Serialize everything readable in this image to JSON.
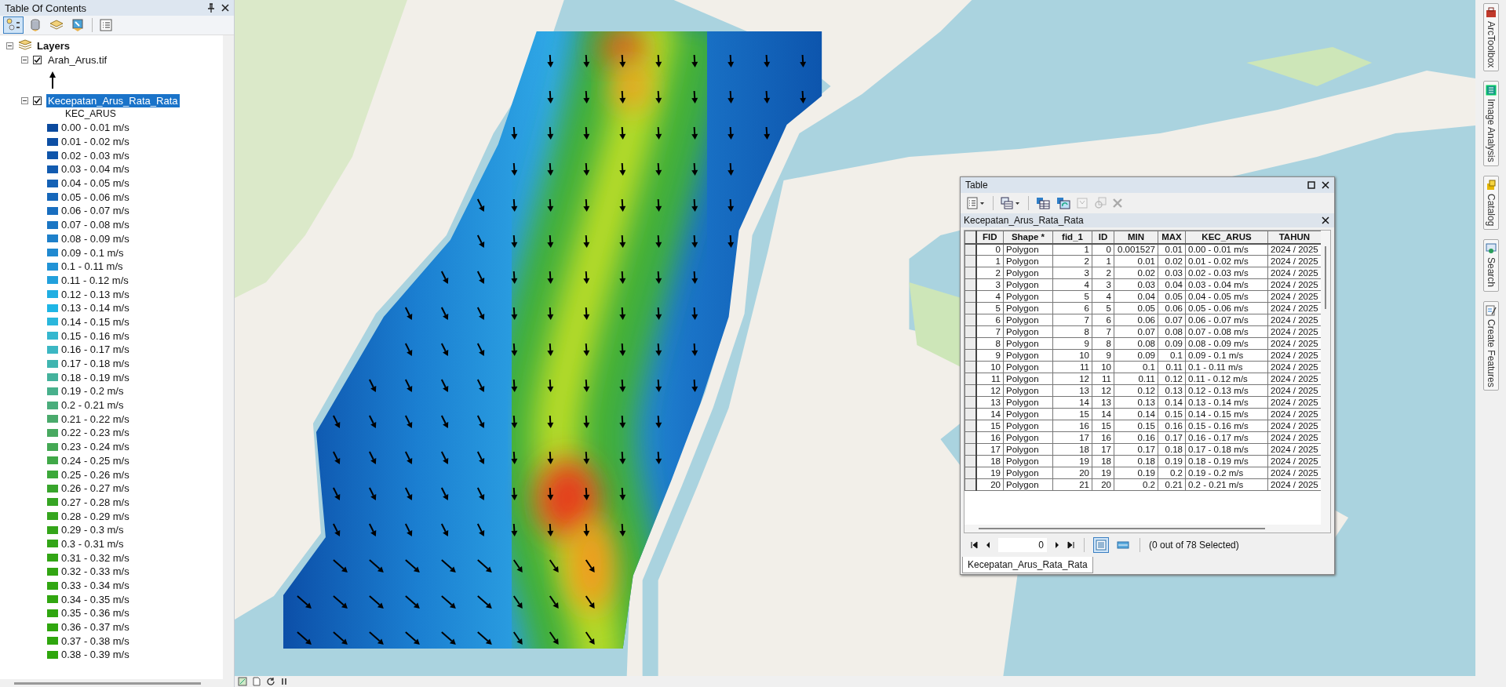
{
  "toc": {
    "title": "Table Of Contents",
    "root": {
      "label": "Layers",
      "expanded": true
    },
    "layers": [
      {
        "kind": "arrow-raster",
        "name": "Arah_Arus.tif",
        "checked": true,
        "expanded": true,
        "selected": false
      },
      {
        "kind": "classes",
        "name": "Kecepatan_Arus_Rata_Rata",
        "checked": true,
        "expanded": true,
        "selected": true,
        "field": "KEC_ARUS",
        "classes": [
          {
            "label": "0.00 - 0.01 m/s",
            "color": "#0b4a9e"
          },
          {
            "label": "0.01 - 0.02 m/s",
            "color": "#0d4fa4"
          },
          {
            "label": "0.02 - 0.03 m/s",
            "color": "#0f55aa"
          },
          {
            "label": "0.03 - 0.04 m/s",
            "color": "#125bb0"
          },
          {
            "label": "0.04 - 0.05 m/s",
            "color": "#1461b5"
          },
          {
            "label": "0.05 - 0.06 m/s",
            "color": "#1667ba"
          },
          {
            "label": "0.06 - 0.07 m/s",
            "color": "#196ebf"
          },
          {
            "label": "0.07 - 0.08 m/s",
            "color": "#1b76c4"
          },
          {
            "label": "0.08 - 0.09 m/s",
            "color": "#1e80ca"
          },
          {
            "label": "0.09 - 0.1 m/s",
            "color": "#2089d0"
          },
          {
            "label": "0.1 - 0.11 m/s",
            "color": "#2193d6"
          },
          {
            "label": "0.11 - 0.12 m/s",
            "color": "#22a0dc"
          },
          {
            "label": "0.12 - 0.13 m/s",
            "color": "#20aee2"
          },
          {
            "label": "0.13 - 0.14 m/s",
            "color": "#1eb6e6"
          },
          {
            "label": "0.14 - 0.15 m/s",
            "color": "#2ab7dc"
          },
          {
            "label": "0.15 - 0.16 m/s",
            "color": "#35b7cf"
          },
          {
            "label": "0.16 - 0.17 m/s",
            "color": "#3cb7c3"
          },
          {
            "label": "0.17 - 0.18 m/s",
            "color": "#40b5b0"
          },
          {
            "label": "0.18 - 0.19 m/s",
            "color": "#44b29c"
          },
          {
            "label": "0.19 - 0.2 m/s",
            "color": "#48b08c"
          },
          {
            "label": "0.2 - 0.21 m/s",
            "color": "#4aad7c"
          },
          {
            "label": "0.21 - 0.22 m/s",
            "color": "#4aaa6c"
          },
          {
            "label": "0.22 - 0.23 m/s",
            "color": "#48a960"
          },
          {
            "label": "0.23 - 0.24 m/s",
            "color": "#44a854"
          },
          {
            "label": "0.24 - 0.25 m/s",
            "color": "#40a848"
          },
          {
            "label": "0.25 - 0.26 m/s",
            "color": "#3ca83a"
          },
          {
            "label": "0.26 - 0.27 m/s",
            "color": "#38a52c"
          },
          {
            "label": "0.27 - 0.28 m/s",
            "color": "#36a524"
          },
          {
            "label": "0.28 - 0.29 m/s",
            "color": "#35a51e"
          },
          {
            "label": "0.29 - 0.3 m/s",
            "color": "#34a51a"
          },
          {
            "label": "0.3 - 0.31 m/s",
            "color": "#33a517"
          },
          {
            "label": "0.31 - 0.32 m/s",
            "color": "#32a515"
          },
          {
            "label": "0.32 - 0.33 m/s",
            "color": "#32a513"
          },
          {
            "label": "0.33 - 0.34 m/s",
            "color": "#31a612"
          },
          {
            "label": "0.34 - 0.35 m/s",
            "color": "#31a611"
          },
          {
            "label": "0.35 - 0.36 m/s",
            "color": "#30a610"
          },
          {
            "label": "0.36 - 0.37 m/s",
            "color": "#30a60f"
          },
          {
            "label": "0.37 - 0.38 m/s",
            "color": "#2fa60e"
          },
          {
            "label": "0.38 - 0.39 m/s",
            "color": "#2fa60d"
          }
        ]
      }
    ]
  },
  "table": {
    "title": "Table",
    "layer_tab": "Kecepatan_Arus_Rata_Rata",
    "columns": [
      "FID",
      "Shape *",
      "fid_1",
      "ID",
      "MIN",
      "MAX",
      "KEC_ARUS",
      "TAHUN"
    ],
    "rows": [
      {
        "selected": false,
        "cells": [
          "0",
          "Polygon",
          "1",
          "0",
          "0.001527",
          "0.01",
          "0.00 - 0.01 m/s",
          "2024 / 2025"
        ]
      },
      {
        "selected": false,
        "cells": [
          "1",
          "Polygon",
          "2",
          "1",
          "0.01",
          "0.02",
          "0.01 - 0.02 m/s",
          "2024 / 2025"
        ]
      },
      {
        "selected": false,
        "cells": [
          "2",
          "Polygon",
          "3",
          "2",
          "0.02",
          "0.03",
          "0.02 - 0.03 m/s",
          "2024 / 2025"
        ]
      },
      {
        "selected": false,
        "cells": [
          "3",
          "Polygon",
          "4",
          "3",
          "0.03",
          "0.04",
          "0.03 - 0.04 m/s",
          "2024 / 2025"
        ]
      },
      {
        "selected": false,
        "cells": [
          "4",
          "Polygon",
          "5",
          "4",
          "0.04",
          "0.05",
          "0.04 - 0.05 m/s",
          "2024 / 2025"
        ]
      },
      {
        "selected": false,
        "cells": [
          "5",
          "Polygon",
          "6",
          "5",
          "0.05",
          "0.06",
          "0.05 - 0.06 m/s",
          "2024 / 2025"
        ]
      },
      {
        "selected": false,
        "cells": [
          "6",
          "Polygon",
          "7",
          "6",
          "0.06",
          "0.07",
          "0.06 - 0.07 m/s",
          "2024 / 2025"
        ]
      },
      {
        "selected": false,
        "cells": [
          "7",
          "Polygon",
          "8",
          "7",
          "0.07",
          "0.08",
          "0.07 - 0.08 m/s",
          "2024 / 2025"
        ]
      },
      {
        "selected": false,
        "cells": [
          "8",
          "Polygon",
          "9",
          "8",
          "0.08",
          "0.09",
          "0.08 - 0.09 m/s",
          "2024 / 2025"
        ]
      },
      {
        "selected": false,
        "cells": [
          "9",
          "Polygon",
          "10",
          "9",
          "0.09",
          "0.1",
          "0.09 - 0.1 m/s",
          "2024 / 2025"
        ]
      },
      {
        "selected": false,
        "cells": [
          "10",
          "Polygon",
          "11",
          "10",
          "0.1",
          "0.11",
          "0.1 - 0.11 m/s",
          "2024 / 2025"
        ]
      },
      {
        "selected": false,
        "cells": [
          "11",
          "Polygon",
          "12",
          "11",
          "0.11",
          "0.12",
          "0.11 - 0.12 m/s",
          "2024 / 2025"
        ]
      },
      {
        "selected": false,
        "cells": [
          "12",
          "Polygon",
          "13",
          "12",
          "0.12",
          "0.13",
          "0.12 - 0.13 m/s",
          "2024 / 2025"
        ]
      },
      {
        "selected": false,
        "cells": [
          "13",
          "Polygon",
          "14",
          "13",
          "0.13",
          "0.14",
          "0.13 - 0.14 m/s",
          "2024 / 2025"
        ]
      },
      {
        "selected": false,
        "cells": [
          "14",
          "Polygon",
          "15",
          "14",
          "0.14",
          "0.15",
          "0.14 - 0.15 m/s",
          "2024 / 2025"
        ]
      },
      {
        "selected": false,
        "cells": [
          "15",
          "Polygon",
          "16",
          "15",
          "0.15",
          "0.16",
          "0.15 - 0.16 m/s",
          "2024 / 2025"
        ]
      },
      {
        "selected": false,
        "cells": [
          "16",
          "Polygon",
          "17",
          "16",
          "0.16",
          "0.17",
          "0.16 - 0.17 m/s",
          "2024 / 2025"
        ]
      },
      {
        "selected": false,
        "cells": [
          "17",
          "Polygon",
          "18",
          "17",
          "0.17",
          "0.18",
          "0.17 - 0.18 m/s",
          "2024 / 2025"
        ]
      },
      {
        "selected": false,
        "cells": [
          "18",
          "Polygon",
          "19",
          "18",
          "0.18",
          "0.19",
          "0.18 - 0.19 m/s",
          "2024 / 2025"
        ]
      },
      {
        "selected": false,
        "cells": [
          "19",
          "Polygon",
          "20",
          "19",
          "0.19",
          "0.2",
          "0.19 - 0.2 m/s",
          "2024 / 2025"
        ]
      },
      {
        "selected": false,
        "cells": [
          "20",
          "Polygon",
          "21",
          "20",
          "0.2",
          "0.21",
          "0.2 - 0.21 m/s",
          "2024 / 2025"
        ]
      }
    ],
    "record": "0",
    "selection_status": "(0 out of 78 Selected)",
    "bottom_tab": "Kecepatan_Arus_Rata_Rata"
  },
  "side_tabs": [
    "ArcToolbox",
    "Image Analysis",
    "Catalog",
    "Search",
    "Create Features"
  ]
}
